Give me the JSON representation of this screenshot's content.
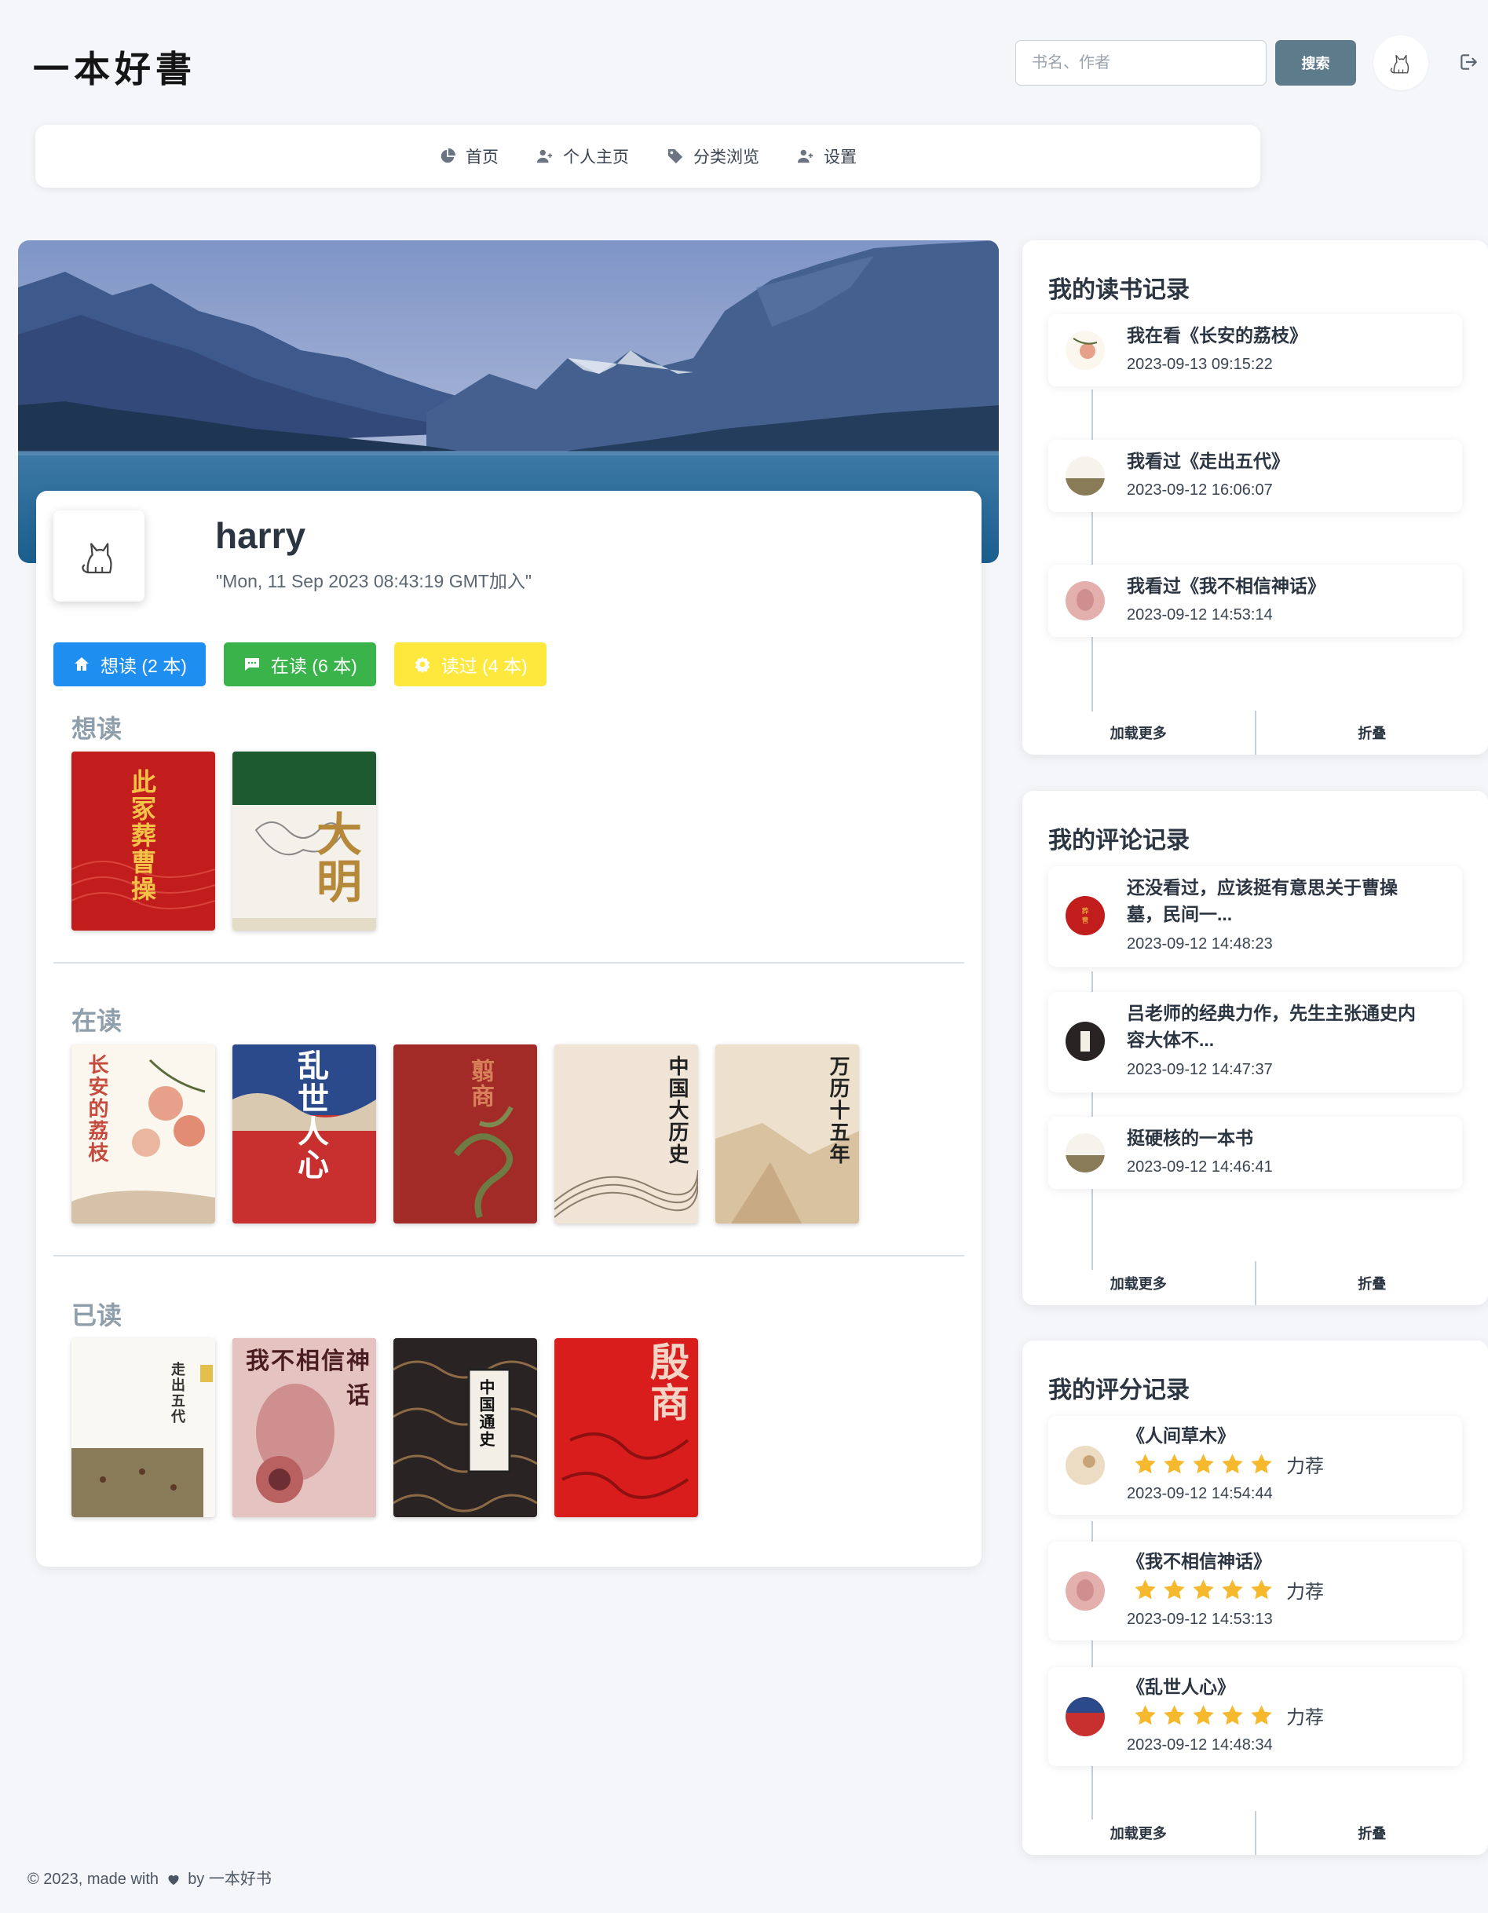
{
  "header": {
    "logo": "一本好書",
    "search_placeholder": "书名、作者",
    "search_button": "搜索"
  },
  "nav": {
    "items": [
      {
        "label": "首页",
        "icon": "pie-chart-icon"
      },
      {
        "label": "个人主页",
        "icon": "user-plus-icon"
      },
      {
        "label": "分类浏览",
        "icon": "tag-icon"
      },
      {
        "label": "设置",
        "icon": "user-plus-icon"
      }
    ]
  },
  "profile": {
    "username": "harry",
    "join_date": "\"Mon, 11 Sep 2023 08:43:19 GMT加入\"",
    "tabs": [
      {
        "label": "想读 (2 本)",
        "icon": "home-icon",
        "color": "#1f8ef1"
      },
      {
        "label": "在读 (6 本)",
        "icon": "chat-icon",
        "color": "#39b34a"
      },
      {
        "label": "读过 (4 本)",
        "icon": "gear-icon",
        "color": "#ffe83d"
      }
    ]
  },
  "shelves": {
    "want": {
      "title": "想读",
      "books": [
        {
          "cover_text": "此冢葬曹操",
          "bg": "#c21d1d"
        },
        {
          "cover_text": "大明",
          "bg": "#f4f1ea"
        }
      ]
    },
    "reading": {
      "title": "在读",
      "books": [
        {
          "cover_text": "长安的荔枝",
          "bg": "#fbf7ef"
        },
        {
          "cover_text": "乱世人心",
          "bg": "#c7302f"
        },
        {
          "cover_text": "翦商",
          "bg": "#a22b27"
        },
        {
          "cover_text": "中国大历史",
          "bg": "#efe4d6"
        },
        {
          "cover_text": "万历十五年",
          "bg": "#ede1cd"
        }
      ]
    },
    "read": {
      "title": "已读",
      "books": [
        {
          "cover_text": "走出五代",
          "bg": "#faf8f3"
        },
        {
          "cover_text": "我不相信神话",
          "bg": "#b7242d"
        },
        {
          "cover_text": "中国通史",
          "bg": "#2a2324"
        },
        {
          "cover_text": "殷商",
          "bg": "#d91d1d"
        }
      ]
    }
  },
  "reading_log": {
    "title": "我的读书记录",
    "entries": [
      {
        "text": "我在看《长安的荔枝》",
        "time": "2023-09-13 09:15:22"
      },
      {
        "text": "我看过《走出五代》",
        "time": "2023-09-12 16:06:07"
      },
      {
        "text": "我看过《我不相信神话》",
        "time": "2023-09-12 14:53:14"
      }
    ],
    "load_more": "加载更多",
    "collapse": "折叠"
  },
  "comment_log": {
    "title": "我的评论记录",
    "entries": [
      {
        "text_line1": "还没看过，应该挺有意思关于曹操",
        "text_line2": "墓，民间一...",
        "time": "2023-09-12 14:48:23"
      },
      {
        "text_line1": "吕老师的经典力作，先生主张通史内",
        "text_line2": "容大体不...",
        "time": "2023-09-12 14:47:37"
      },
      {
        "text_line1": "挺硬核的一本书",
        "time": "2023-09-12 14:46:41"
      }
    ],
    "load_more": "加载更多",
    "collapse": "折叠"
  },
  "rating_log": {
    "title": "我的评分记录",
    "entries": [
      {
        "book": "《人间草木》",
        "stars": 5,
        "verdict": "力荐",
        "time": "2023-09-12 14:54:44"
      },
      {
        "book": "《我不相信神话》",
        "stars": 5,
        "verdict": "力荐",
        "time": "2023-09-12 14:53:13"
      },
      {
        "book": "《乱世人心》",
        "stars": 5,
        "verdict": "力荐",
        "time": "2023-09-12 14:48:34"
      }
    ],
    "load_more": "加载更多",
    "collapse": "折叠"
  },
  "footer": {
    "text_before": "© 2023, made with",
    "text_after": "by 一本好书"
  },
  "colors": {
    "accent": "#5e7b8c",
    "star": "#f6b82c",
    "muted_heading": "#8e9eaa"
  }
}
